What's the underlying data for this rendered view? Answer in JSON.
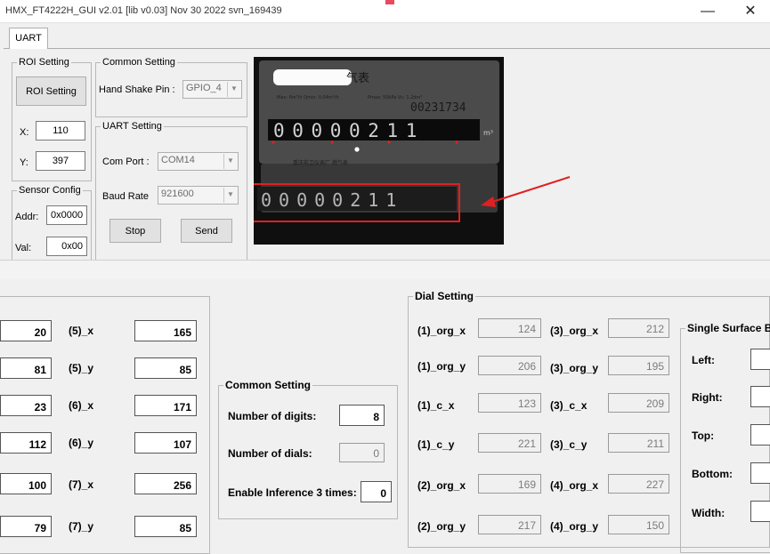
{
  "window": {
    "title": "HMX_FT4222H_GUI v2.01 [lib v0.03] Nov 30 2022 svn_169439",
    "tab": "UART"
  },
  "roi_setting": {
    "group": "ROI Setting",
    "button": "ROI Setting",
    "x_label": "X:",
    "x_value": "110",
    "y_label": "Y:",
    "y_value": "397"
  },
  "sensor_config": {
    "group": "Sensor Config",
    "addr_label": "Addr:",
    "addr_value": "0x0000",
    "val_label": "Val:",
    "val_value": "0x00"
  },
  "common_setting_top": {
    "group": "Common Setting",
    "handshake_label": "Hand Shake Pin :",
    "handshake_value": "GPIO_4"
  },
  "uart_setting": {
    "group": "UART Setting",
    "comport_label": "Com Port :",
    "comport_value": "COM14",
    "baud_label": "Baud Rate",
    "baud_value": "921600",
    "stop_button": "Stop",
    "send_button": "Send"
  },
  "camera": {
    "meter_chars": "气表",
    "meter_spec_left": "Max: 6m³/h  Qmin: 0.04m³/h",
    "meter_spec_right": "Pmax: 50kPa  Vc: 1.2dm³",
    "serial": "00231734",
    "reading": "00000211",
    "reading_unit": "m³",
    "chinese_line": "重庆前卫仪表厂 燃气表",
    "roi_reading": "00000211"
  },
  "roi_points": {
    "left": [
      {
        "label": "",
        "value": "20"
      },
      {
        "label": "",
        "value": "81"
      },
      {
        "label": "",
        "value": "23"
      },
      {
        "label": "",
        "value": "112"
      },
      {
        "label": "",
        "value": "100"
      },
      {
        "label": "",
        "value": "79"
      }
    ],
    "right": [
      {
        "label": "(5)_x",
        "value": "165"
      },
      {
        "label": "(5)_y",
        "value": "85"
      },
      {
        "label": "(6)_x",
        "value": "171"
      },
      {
        "label": "(6)_y",
        "value": "107"
      },
      {
        "label": "(7)_x",
        "value": "256"
      },
      {
        "label": "(7)_y",
        "value": "85"
      }
    ]
  },
  "common_setting_bottom": {
    "group": "Common Setting",
    "digits_label": "Number of digits:",
    "digits_value": "8",
    "dials_label": "Number of dials:",
    "dials_value": "0",
    "inference_label": "Enable Inference 3 times:",
    "inference_value": "0"
  },
  "dial_setting": {
    "group": "Dial Setting",
    "left": [
      {
        "label": "(1)_org_x",
        "value": "124"
      },
      {
        "label": "(1)_org_y",
        "value": "206"
      },
      {
        "label": "(1)_c_x",
        "value": "123"
      },
      {
        "label": "(1)_c_y",
        "value": "221"
      },
      {
        "label": "(2)_org_x",
        "value": "169"
      },
      {
        "label": "(2)_org_y",
        "value": "217"
      }
    ],
    "right": [
      {
        "label": "(3)_org_x",
        "value": "212"
      },
      {
        "label": "(3)_org_y",
        "value": "195"
      },
      {
        "label": "(3)_c_x",
        "value": "209"
      },
      {
        "label": "(3)_c_y",
        "value": "211"
      },
      {
        "label": "(4)_org_x",
        "value": "227"
      },
      {
        "label": "(4)_org_y",
        "value": "150"
      }
    ]
  },
  "single_surface": {
    "group": "Single Surface B",
    "left_label": "Left:",
    "right_label": "Right:",
    "top_label": "Top:",
    "bottom_label": "Bottom:",
    "width_label": "Width:"
  },
  "colors": {
    "annotation_red": "#e02020"
  }
}
